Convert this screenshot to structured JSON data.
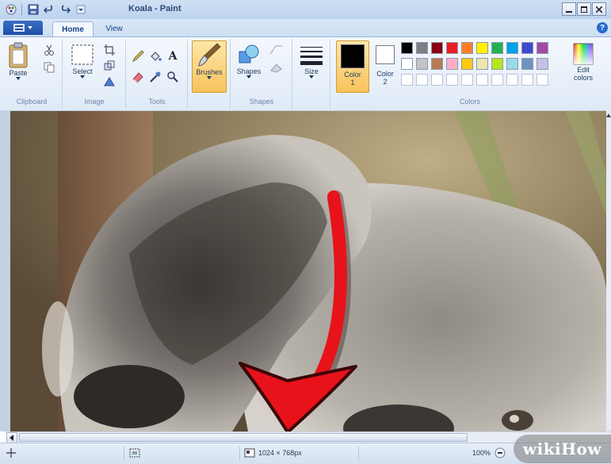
{
  "window": {
    "title": "Koala - Paint"
  },
  "tabs": [
    {
      "label": "Home",
      "selected": true
    },
    {
      "label": "View",
      "selected": false
    }
  ],
  "ribbon": {
    "clipboard": {
      "paste_label": "Paste",
      "group_label": "Clipboard"
    },
    "image": {
      "select_label": "Select",
      "group_label": "Image"
    },
    "tools": {
      "group_label": "Tools"
    },
    "brushes": {
      "label": "Brushes"
    },
    "shapes": {
      "label": "Shapes",
      "group_label": "Shapes"
    },
    "size": {
      "label": "Size"
    },
    "colors": {
      "color1_label": "Color",
      "color1_num": "1",
      "color2_label": "Color",
      "color2_num": "2",
      "edit_label": "Edit",
      "edit_label2": "colors",
      "group_label": "Colors",
      "color1_value": "#000000",
      "color2_value": "#ffffff",
      "palette_row1": [
        "#000000",
        "#7f7f7f",
        "#880015",
        "#ed1c24",
        "#ff7f27",
        "#fff200",
        "#22b14c",
        "#00a2e8",
        "#3f48cc",
        "#a349a4"
      ],
      "palette_row2": [
        "#ffffff",
        "#c3c3c3",
        "#b97a57",
        "#ffaec9",
        "#ffc90e",
        "#efe4b0",
        "#b5e61d",
        "#99d9ea",
        "#7092be",
        "#c8bfe7"
      ],
      "palette_row3": [
        "#ffffff",
        "#ffffff",
        "#ffffff",
        "#ffffff",
        "#ffffff",
        "#ffffff",
        "#ffffff",
        "#ffffff",
        "#ffffff",
        "#ffffff"
      ]
    }
  },
  "statusbar": {
    "dimensions": "1024 × 768px",
    "zoom": "100%"
  },
  "watermark": "wikiHow",
  "annotation": {
    "color": "#e8121a",
    "shape": "curved-arrow-down"
  }
}
